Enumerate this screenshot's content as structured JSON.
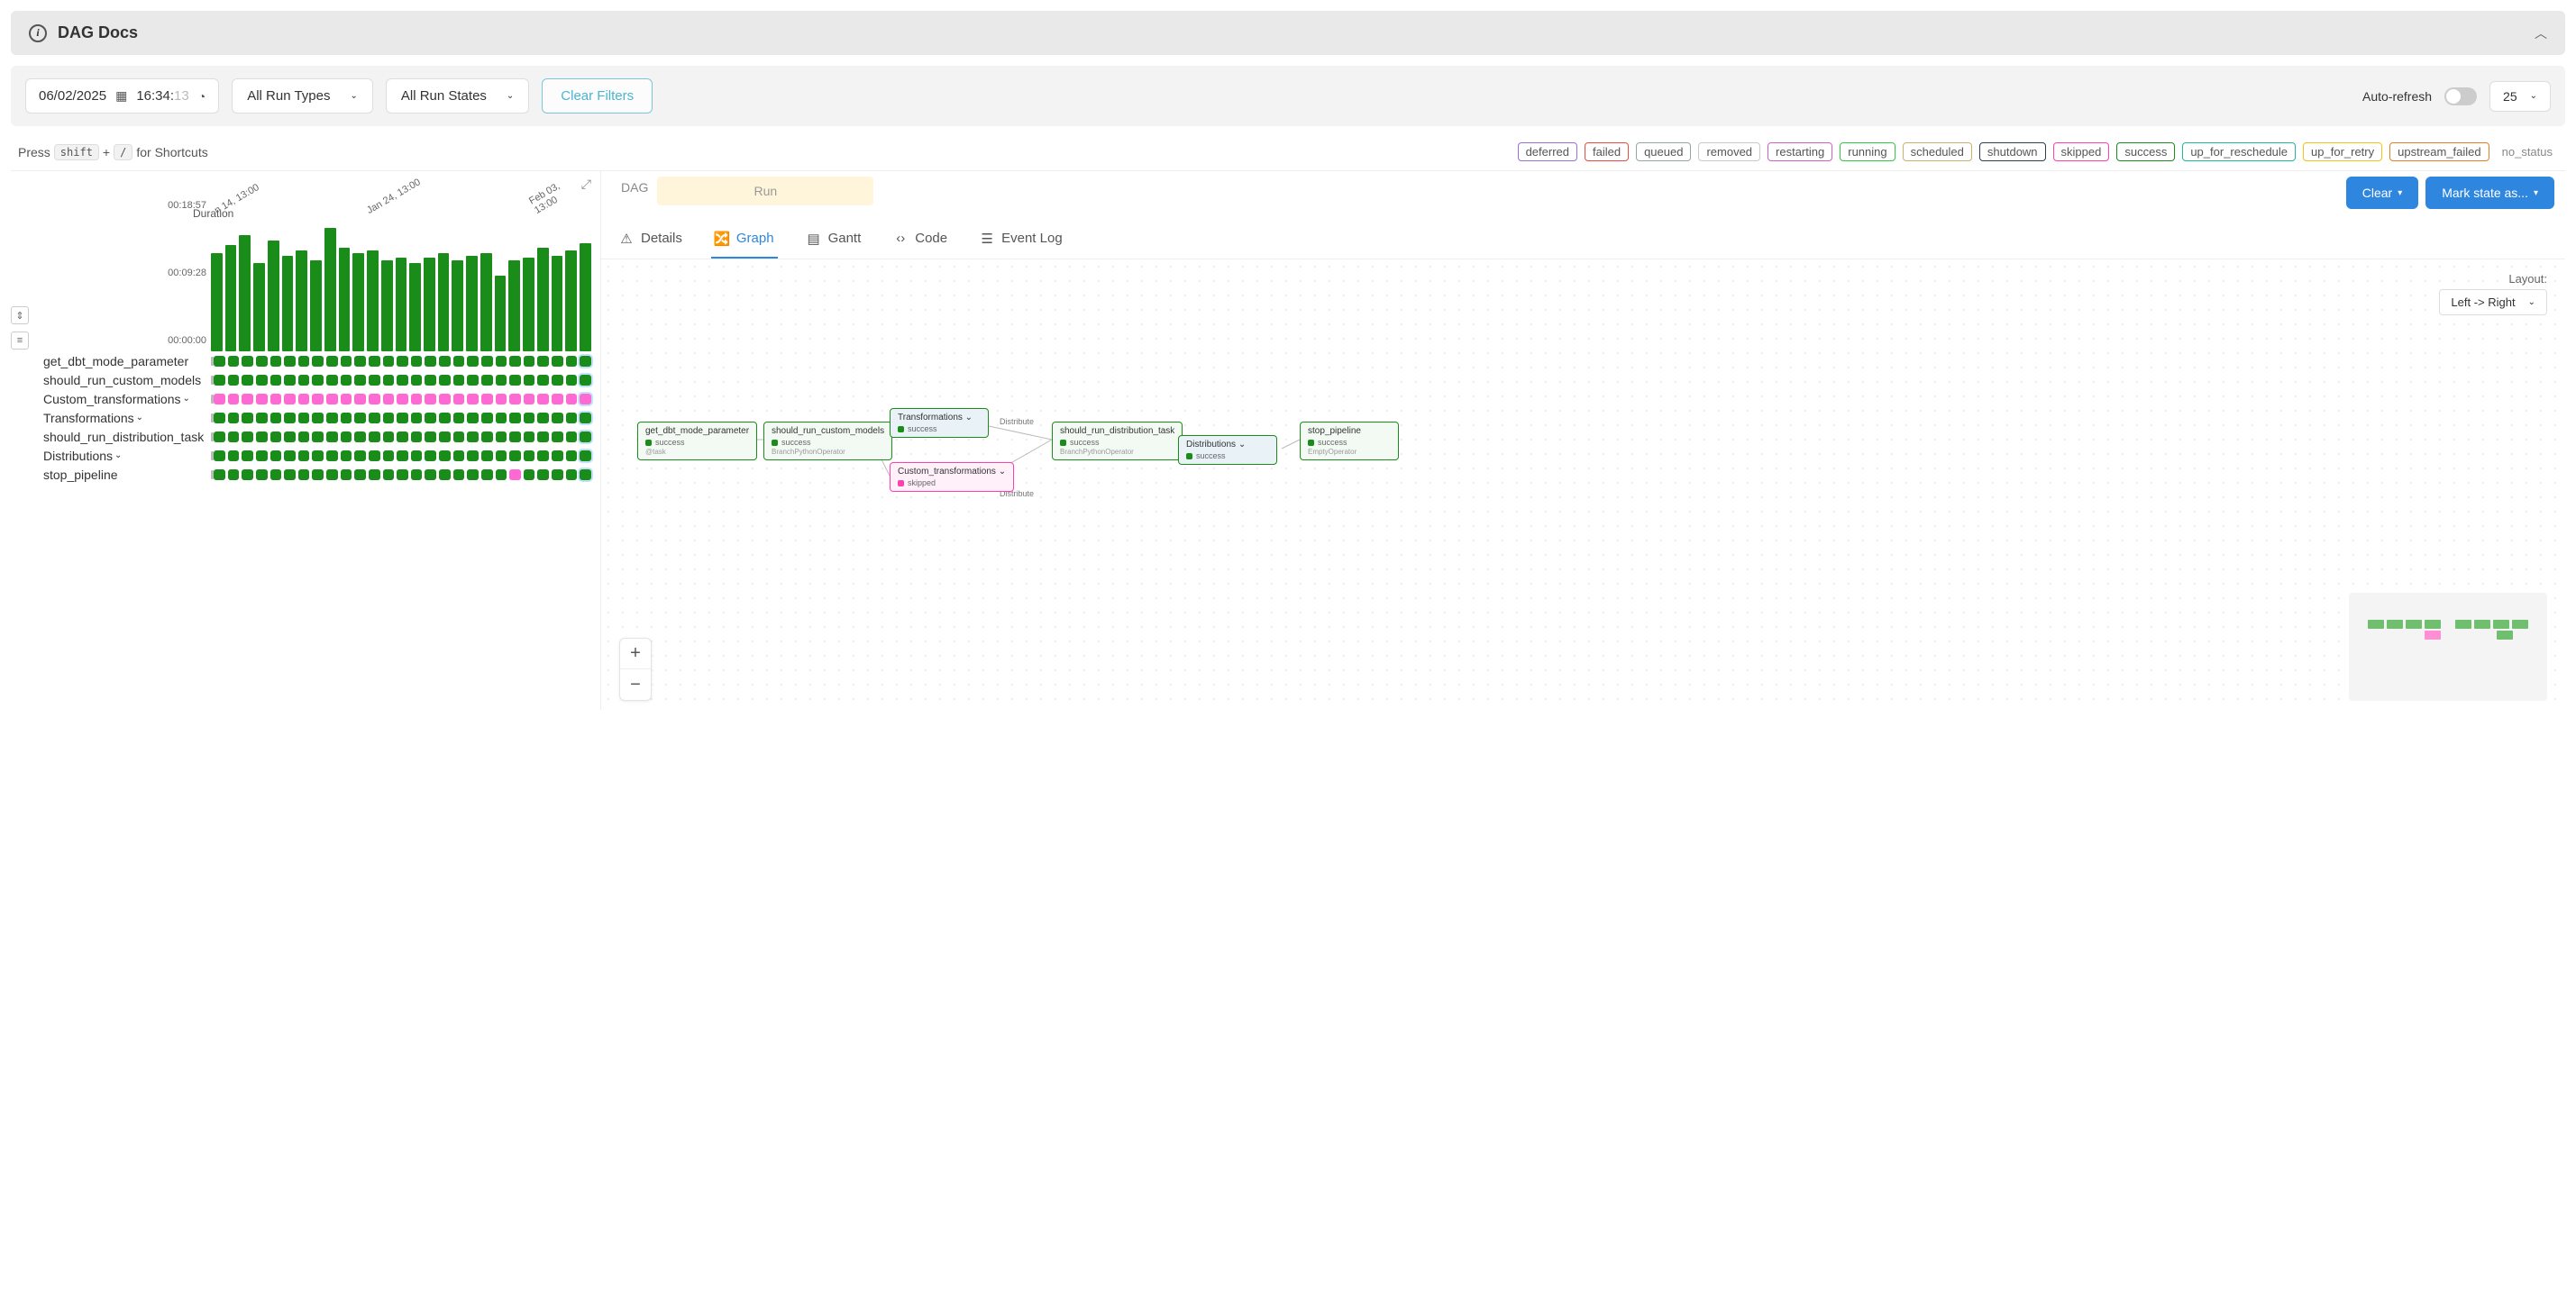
{
  "header": {
    "title": "DAG Docs"
  },
  "filters": {
    "date": "06/02/2025",
    "time_pre": "16:34:",
    "time_sec": "13",
    "run_types": "All Run Types",
    "run_states": "All Run States",
    "clear_label": "Clear Filters",
    "auto_refresh_label": "Auto-refresh",
    "page_size": "25"
  },
  "shortcut": {
    "press": "Press",
    "shift": "shift",
    "plus": "+",
    "slash": "/",
    "for": "for Shortcuts"
  },
  "legend": [
    {
      "name": "deferred",
      "color": "#9a6fd6"
    },
    {
      "name": "failed",
      "color": "#e74c3c"
    },
    {
      "name": "queued",
      "color": "#95a5a6"
    },
    {
      "name": "removed",
      "color": "#c9c9c9"
    },
    {
      "name": "restarting",
      "color": "#d35fc3"
    },
    {
      "name": "running",
      "color": "#2ecc40"
    },
    {
      "name": "scheduled",
      "color": "#cbb26a"
    },
    {
      "name": "shutdown",
      "color": "#2c3e50"
    },
    {
      "name": "skipped",
      "color": "#ff3fb0"
    },
    {
      "name": "success",
      "color": "#1a8c1a"
    },
    {
      "name": "up_for_reschedule",
      "color": "#1abc9c"
    },
    {
      "name": "up_for_retry",
      "color": "#f1c40f"
    },
    {
      "name": "upstream_failed",
      "color": "#e67e22"
    }
  ],
  "no_status": "no_status",
  "breadcrumb": {
    "dag": "DAG",
    "run": "Run"
  },
  "actions": {
    "clear": "Clear",
    "mark": "Mark state as..."
  },
  "tabs": {
    "details": "Details",
    "graph": "Graph",
    "gantt": "Gantt",
    "code": "Code",
    "eventlog": "Event Log"
  },
  "layout": {
    "label": "Layout:",
    "value": "Left -> Right"
  },
  "chart_data": {
    "type": "bar",
    "y_title": "Duration",
    "y_ticks": [
      "00:00:00",
      "00:09:28",
      "00:18:57"
    ],
    "dates": [
      {
        "label": "n 14, 13:00",
        "pos": 2
      },
      {
        "label": "Jan 24, 13:00",
        "pos": 42
      },
      {
        "label": "Feb 03, 13:00",
        "pos": 86
      }
    ],
    "bars": [
      78,
      84,
      92,
      70,
      88,
      76,
      80,
      72,
      98,
      82,
      78,
      80,
      72,
      74,
      70,
      74,
      78,
      72,
      76,
      78,
      60,
      72,
      74,
      82,
      76,
      80,
      86
    ]
  },
  "tasks": [
    {
      "name": "get_dbt_mode_parameter",
      "expandable": false,
      "cells": "all_success"
    },
    {
      "name": "should_run_custom_models",
      "expandable": false,
      "cells": "all_success"
    },
    {
      "name": "Custom_transformations",
      "expandable": true,
      "cells": "all_skipped"
    },
    {
      "name": "Transformations",
      "expandable": true,
      "cells": "all_success"
    },
    {
      "name": "should_run_distribution_task",
      "expandable": false,
      "cells": "all_success"
    },
    {
      "name": "Distributions",
      "expandable": true,
      "cells": "all_success"
    },
    {
      "name": "stop_pipeline",
      "expandable": false,
      "cells": "stop_mix"
    }
  ],
  "graph_nodes": {
    "n1": {
      "title": "get_dbt_mode_parameter",
      "status": "success",
      "op": "@task"
    },
    "n2": {
      "title": "should_run_custom_models",
      "status": "success",
      "op": "BranchPythonOperator"
    },
    "n3": {
      "title": "Transformations",
      "status": "success"
    },
    "n4": {
      "title": "Custom_transformations",
      "status": "skipped"
    },
    "n5": {
      "title": "should_run_distribution_task",
      "status": "success",
      "op": "BranchPythonOperator"
    },
    "n6": {
      "title": "Distributions",
      "status": "success"
    },
    "n7": {
      "title": "stop_pipeline",
      "status": "success",
      "op": "EmptyOperator"
    },
    "edge1": "Distribute",
    "edge2": "Distribute"
  },
  "status_colors": {
    "success": "#1a8c1a",
    "skipped": "#ff3fb0"
  }
}
